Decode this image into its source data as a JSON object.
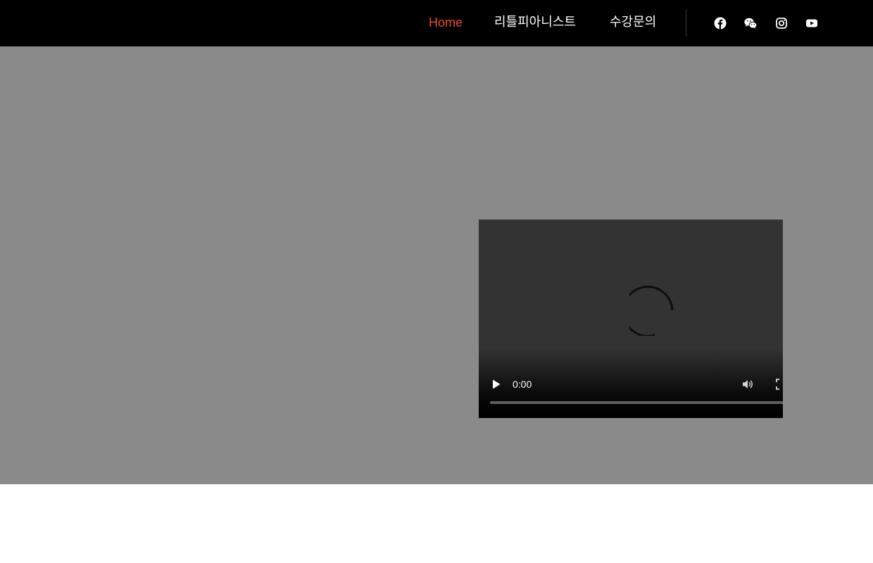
{
  "header": {
    "nav": [
      {
        "label": "Home",
        "active": true
      },
      {
        "label": "리틀피아니스트",
        "active": false
      },
      {
        "label": "수강문의",
        "active": false
      }
    ],
    "social": [
      {
        "icon": "facebook-icon"
      },
      {
        "icon": "wechat-icon"
      },
      {
        "icon": "instagram-icon"
      },
      {
        "icon": "youtube-icon"
      }
    ],
    "active_color": "#e8492b"
  },
  "video": {
    "current_time": "0:00",
    "progress": 0
  }
}
